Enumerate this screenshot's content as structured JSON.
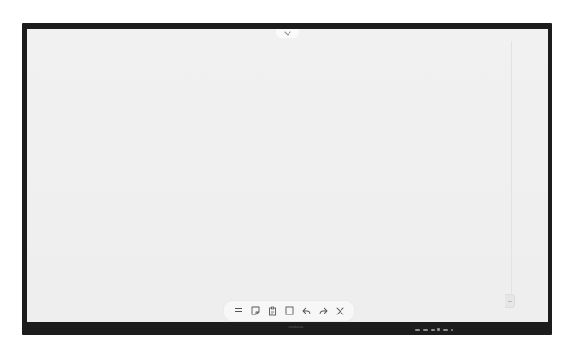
{
  "device": {
    "brand_label": "SAMSUNG",
    "bezel_color": "#1c1c1c",
    "canvas_color": "#efefef"
  },
  "top_tab": {
    "icon": "chevron-down-icon"
  },
  "toolbar": {
    "tools": [
      {
        "name": "menu",
        "icon": "menu-icon"
      },
      {
        "name": "note",
        "icon": "sticky-note-icon"
      },
      {
        "name": "paste",
        "icon": "clipboard-icon"
      },
      {
        "name": "select",
        "icon": "rectangle-select-icon"
      },
      {
        "name": "undo",
        "icon": "undo-icon"
      },
      {
        "name": "redo",
        "icon": "redo-icon"
      },
      {
        "name": "close",
        "icon": "close-icon"
      }
    ]
  },
  "side_handle": {
    "icon": "drag-handle-icon"
  },
  "ports": {
    "icon": "io-ports-icon"
  }
}
